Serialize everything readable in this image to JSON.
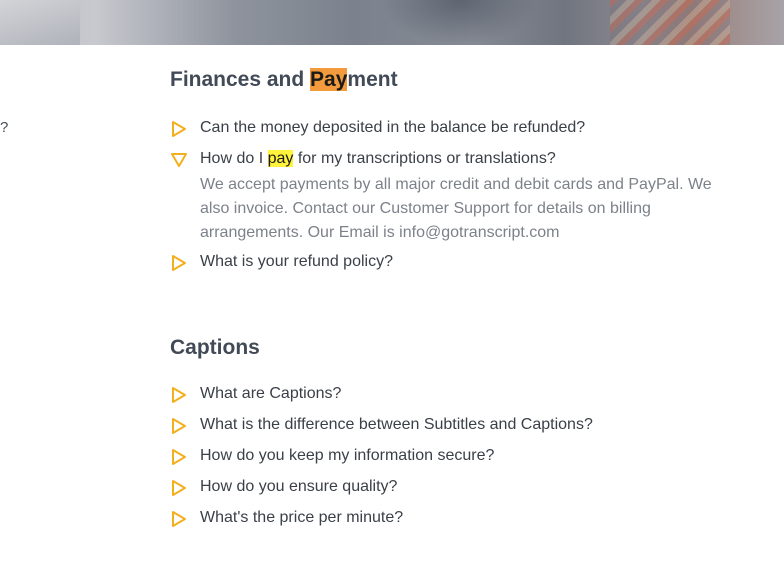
{
  "hero": {
    "description_icon": "hero-photo-banner"
  },
  "sidebar_fragment": {
    "text": "?"
  },
  "sections": {
    "finances": {
      "title_highlight": "Pay",
      "title_rest": "ment",
      "title_prefix": "Finances and ",
      "items": [
        {
          "question": "Can the money deposited in the balance be refunded?"
        },
        {
          "question_prefix": "How do I ",
          "question_highlight": "pay",
          "question_suffix": " for my transcriptions or translations?",
          "answer": "We accept payments by all major credit and debit cards and PayPal. We also invoice. Contact our Customer Support for details on billing arrangements. Our Email is info@gotranscript.com"
        },
        {
          "question": "What is your refund policy?"
        }
      ]
    },
    "captions": {
      "title": "Captions",
      "items": [
        {
          "question": "What are Captions?"
        },
        {
          "question": "What is the difference between Subtitles and Captions?"
        },
        {
          "question": "How do you keep my information secure?"
        },
        {
          "question": "How do you ensure quality?"
        },
        {
          "question": "What's the price per minute?"
        }
      ]
    }
  },
  "colors": {
    "accent_triangle": "#f2b01e",
    "highlight_orange": "#f29a3c",
    "highlight_yellow": "#fff33b",
    "heading": "#414a56",
    "answer_text": "#7d8189"
  },
  "icons": {
    "collapsed": "triangle-right-icon",
    "expanded": "triangle-down-icon"
  }
}
